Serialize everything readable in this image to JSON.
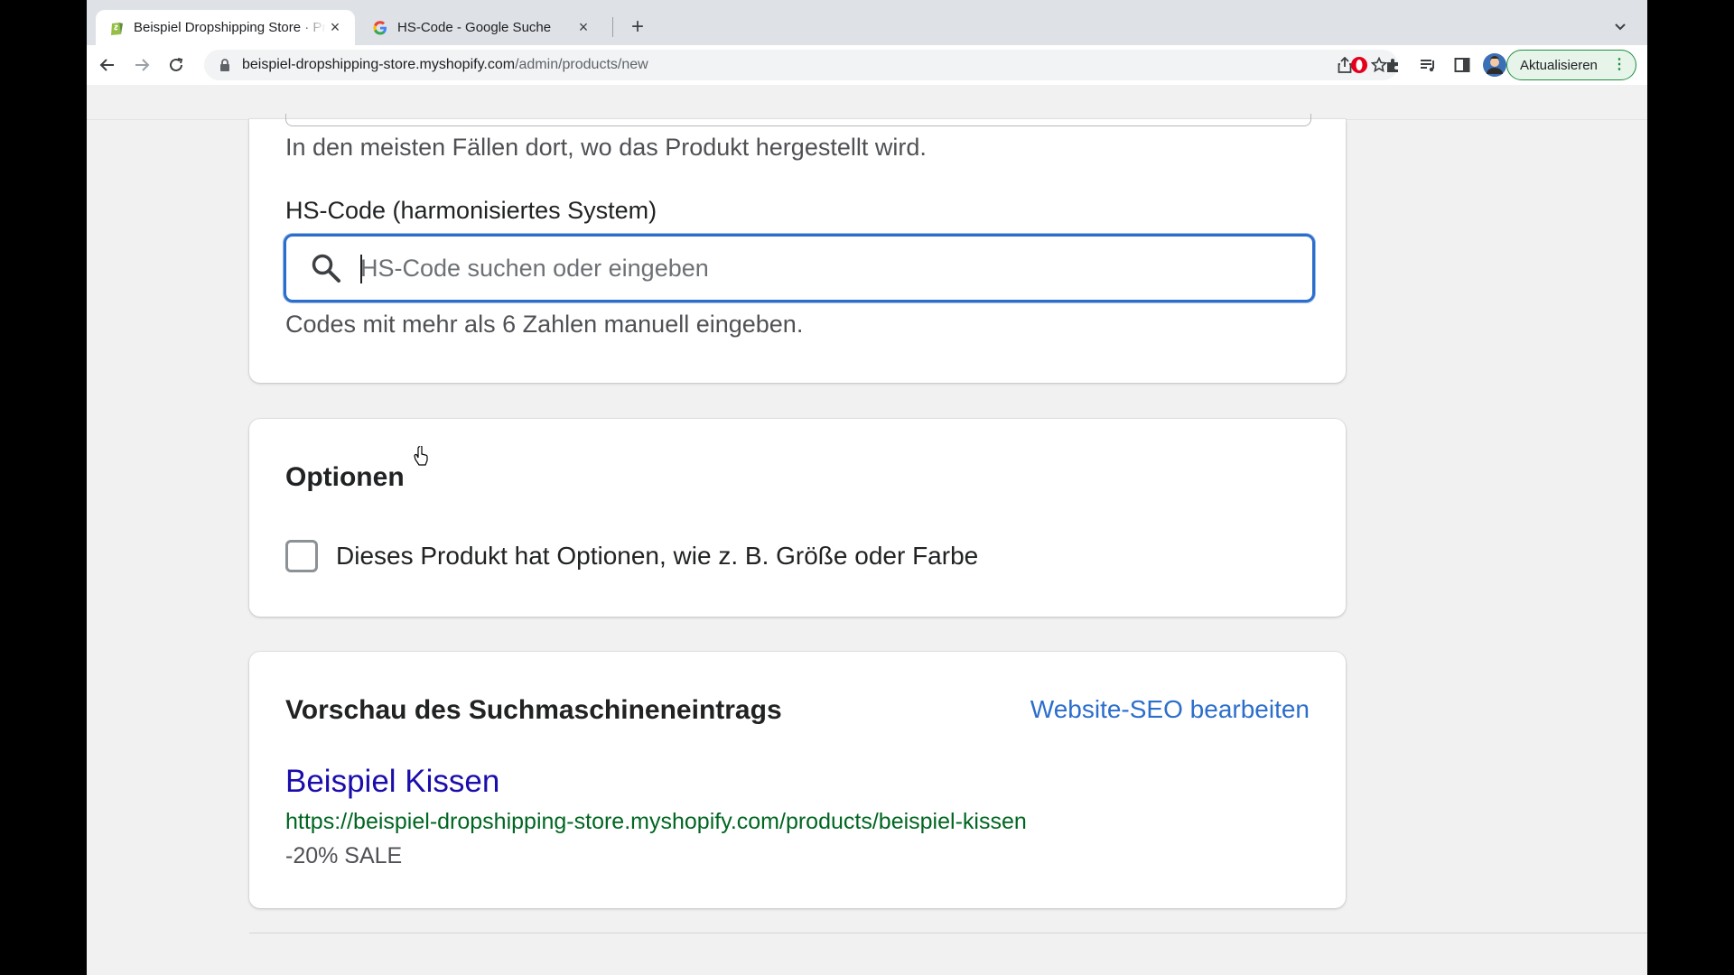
{
  "browser": {
    "tabs": [
      {
        "title": "Beispiel Dropshipping Store · Produkt hinzufügen",
        "favicon": "shopify-icon",
        "active": true
      },
      {
        "title": "HS-Code - Google Suche",
        "favicon": "google-icon",
        "active": false
      }
    ],
    "close_glyph": "×",
    "new_tab_glyph": "+",
    "url_host": "beispiel-dropshipping-store.myshopify.com",
    "url_path": "/admin/products/new",
    "update_label": "Aktualisieren"
  },
  "customs_card": {
    "origin_help": "In den meisten Fällen dort, wo das Produkt hergestellt wird.",
    "hs_label": "HS-Code (harmonisiertes System)",
    "hs_placeholder": "HS-Code suchen oder eingeben",
    "hs_value": "",
    "hs_help": "Codes mit mehr als 6 Zahlen manuell eingeben."
  },
  "options_card": {
    "title": "Optionen",
    "checkbox_label": "Dieses Produkt hat Optionen, wie z. B. Größe oder Farbe",
    "checked": false
  },
  "seo_card": {
    "title": "Vorschau des Suchmaschineneintrags",
    "edit_link": "Website-SEO bearbeiten",
    "preview_title": "Beispiel Kissen",
    "preview_url": "https://beispiel-dropshipping-store.myshopify.com/products/beispiel-kissen",
    "preview_description": "-20% SALE"
  },
  "colors": {
    "focus_blue": "#2c6ecb",
    "link_blue": "#1a0dab",
    "url_green": "#006621",
    "update_green": "#1e8e3e"
  }
}
